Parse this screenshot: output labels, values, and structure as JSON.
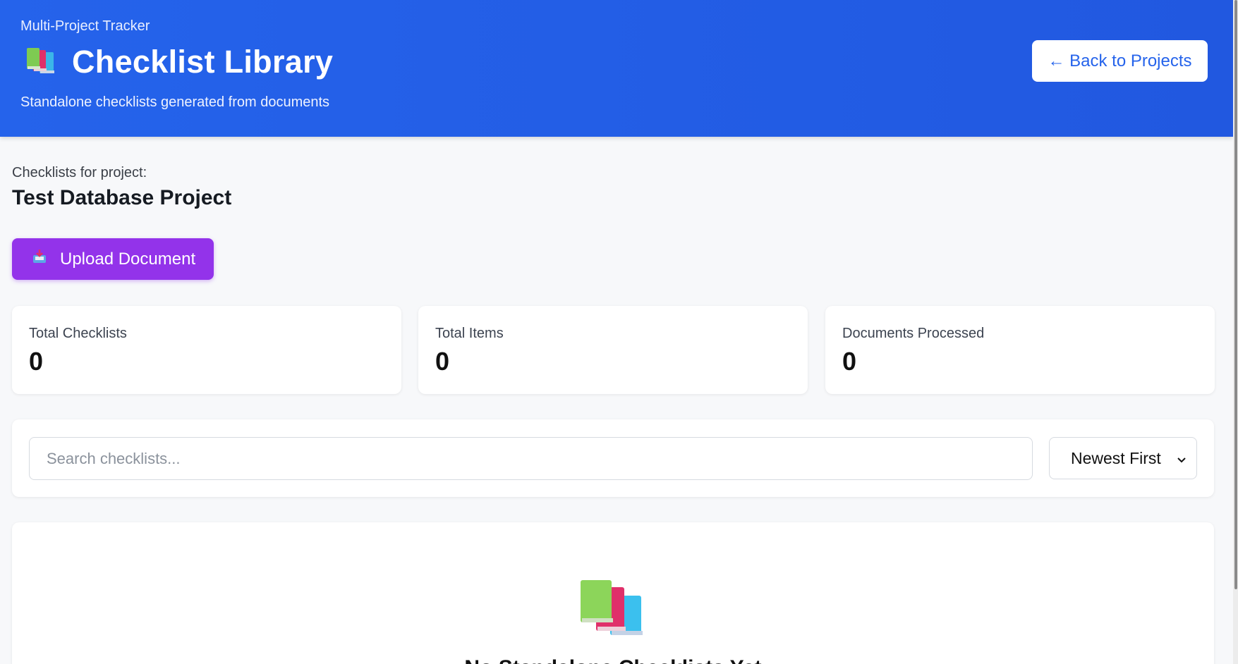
{
  "header": {
    "eyebrow": "Multi-Project Tracker",
    "title": "Checklist Library",
    "title_icon": "books-icon",
    "subtitle": "Standalone checklists generated from documents",
    "back_button": "← Back to Projects"
  },
  "project": {
    "label": "Checklists for project:",
    "name": "Test Database Project"
  },
  "actions": {
    "upload_label": "Upload Document",
    "upload_icon": "inbox-tray-icon"
  },
  "stats": [
    {
      "label": "Total Checklists",
      "value": "0"
    },
    {
      "label": "Total Items",
      "value": "0"
    },
    {
      "label": "Documents Processed",
      "value": "0"
    }
  ],
  "search": {
    "placeholder": "Search checklists...",
    "value": "",
    "sort_selected": "Newest First"
  },
  "empty_state": {
    "icon": "books-icon",
    "title": "No Standalone Checklists Yet"
  },
  "colors": {
    "header": "#2563eb",
    "upload_button": "#9333ea",
    "back_button_text": "#2563eb"
  }
}
